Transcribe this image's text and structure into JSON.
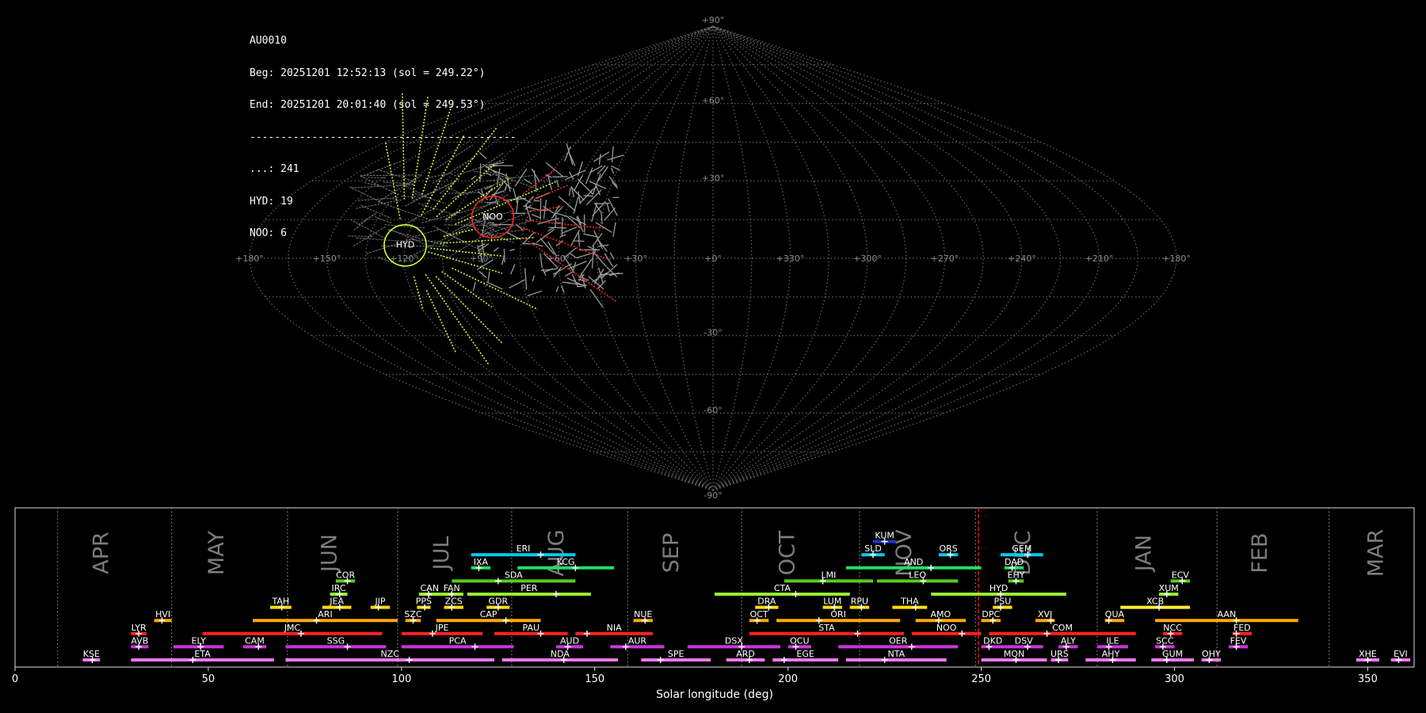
{
  "info": {
    "station": "AU0010",
    "begin": "Beg: 20251201 12:52:13 (sol = 249.22°)",
    "end": "End: 20251201 20:01:40 (sol = 249.53°)",
    "separator": "-------------------------------------------",
    "counts": [
      {
        "label": "...",
        "value": 241
      },
      {
        "label": "HYD",
        "value": 19
      },
      {
        "label": "NOO",
        "value": 6
      }
    ]
  },
  "sky_map": {
    "projection": "sinusoidal",
    "lon_ticks": [
      "+180°",
      "+150°",
      "+120°",
      "+90°",
      "+60°",
      "+30°",
      "+0°",
      "+330°",
      "+300°",
      "+270°",
      "+240°",
      "+210°",
      "+180°"
    ],
    "lat_ticks": [
      "+90°",
      "+60°",
      "+30°",
      "-30°",
      "-60°",
      "-90°"
    ],
    "radiants": [
      {
        "name": "HYD",
        "lon": 120,
        "lat": 5,
        "color": "#ccff33",
        "radius_deg": 5
      },
      {
        "name": "NOO",
        "lon": 89,
        "lat": 16,
        "color": "#ff2222",
        "radius_deg": 5
      }
    ]
  },
  "chart_data": {
    "type": "timeline",
    "xlabel": "Solar longitude (deg)",
    "xlim": [
      0,
      362
    ],
    "x_ticks": [
      0,
      50,
      100,
      150,
      200,
      250,
      300,
      350
    ],
    "current_sol": 249.3,
    "months": [
      {
        "name": "APR",
        "start": 11,
        "end": 40.5
      },
      {
        "name": "MAY",
        "start": 40.5,
        "end": 70.5
      },
      {
        "name": "JUN",
        "start": 70.5,
        "end": 99
      },
      {
        "name": "JUL",
        "start": 99,
        "end": 128.5
      },
      {
        "name": "AUG",
        "start": 128.5,
        "end": 158.5
      },
      {
        "name": "SEP",
        "start": 158.5,
        "end": 188
      },
      {
        "name": "OCT",
        "start": 188,
        "end": 218.5
      },
      {
        "name": "NOV",
        "start": 218.5,
        "end": 248.5
      },
      {
        "name": "DEC",
        "start": 248.5,
        "end": 280
      },
      {
        "name": "JAN",
        "start": 280,
        "end": 311
      },
      {
        "name": "FEB",
        "start": 311,
        "end": 340
      },
      {
        "name": "MAR",
        "start": 340,
        "end": 371
      }
    ],
    "showers": [
      {
        "name": "KSE",
        "start": 17.5,
        "end": 22,
        "peak": 20,
        "level": 0,
        "color": "#ee77ee"
      },
      {
        "name": "ETA",
        "start": 30,
        "end": 67,
        "peak": 46,
        "level": 0,
        "color": "#ee77ee"
      },
      {
        "name": "NZC",
        "start": 70,
        "end": 124,
        "peak": 102,
        "level": 0,
        "color": "#ee77ee"
      },
      {
        "name": "NDA",
        "start": 126,
        "end": 156,
        "peak": 142,
        "level": 0,
        "color": "#ee77ee"
      },
      {
        "name": "SPE",
        "start": 162,
        "end": 180,
        "peak": 167,
        "level": 0,
        "color": "#ee77ee"
      },
      {
        "name": "ARD",
        "start": 184,
        "end": 194,
        "peak": 190,
        "level": 0,
        "color": "#ee77ee"
      },
      {
        "name": "EGE",
        "start": 196,
        "end": 213,
        "peak": 199,
        "level": 0,
        "color": "#ee77ee"
      },
      {
        "name": "NTA",
        "start": 215,
        "end": 241,
        "peak": 225,
        "level": 0,
        "color": "#ee77ee"
      },
      {
        "name": "MON",
        "start": 250,
        "end": 267,
        "peak": 259,
        "level": 0,
        "color": "#ee77ee"
      },
      {
        "name": "URS",
        "start": 268,
        "end": 272.5,
        "peak": 270,
        "level": 0,
        "color": "#ee77ee"
      },
      {
        "name": "AHY",
        "start": 277,
        "end": 290,
        "peak": 284,
        "level": 0,
        "color": "#ee77ee"
      },
      {
        "name": "GUM",
        "start": 294,
        "end": 305,
        "peak": 298,
        "level": 0,
        "color": "#ee77ee"
      },
      {
        "name": "OHY",
        "start": 307,
        "end": 312,
        "peak": 309,
        "level": 0,
        "color": "#ee77ee"
      },
      {
        "name": "XHE",
        "start": 347,
        "end": 353,
        "peak": 350,
        "level": 0,
        "color": "#ee77ee"
      },
      {
        "name": "EVI",
        "start": 356,
        "end": 361,
        "peak": 358,
        "level": 0,
        "color": "#ee77ee"
      },
      {
        "name": "AVB",
        "start": 30,
        "end": 34.5,
        "peak": 32,
        "level": 1,
        "color": "#cc33dd"
      },
      {
        "name": "ELY",
        "start": 41,
        "end": 54,
        "peak": 48,
        "level": 1,
        "color": "#cc33dd"
      },
      {
        "name": "CAM",
        "start": 59,
        "end": 65,
        "peak": 63,
        "level": 1,
        "color": "#cc33dd"
      },
      {
        "name": "SSG",
        "start": 70,
        "end": 96,
        "peak": 86,
        "level": 1,
        "color": "#cc33dd"
      },
      {
        "name": "PCA",
        "start": 100,
        "end": 129,
        "peak": 119,
        "level": 1,
        "color": "#cc33dd"
      },
      {
        "name": "AUD",
        "start": 140,
        "end": 147,
        "peak": 143,
        "level": 1,
        "color": "#cc33dd"
      },
      {
        "name": "AUR",
        "start": 154,
        "end": 168,
        "peak": 158,
        "level": 1,
        "color": "#cc33dd"
      },
      {
        "name": "DSX",
        "start": 174,
        "end": 198,
        "peak": 188,
        "level": 1,
        "color": "#cc33dd"
      },
      {
        "name": "OCU",
        "start": 200,
        "end": 206,
        "peak": 202,
        "level": 1,
        "color": "#cc33dd"
      },
      {
        "name": "OER",
        "start": 213,
        "end": 244,
        "peak": 232,
        "level": 1,
        "color": "#cc33dd"
      },
      {
        "name": "DKD",
        "start": 250,
        "end": 256,
        "peak": 252,
        "level": 1,
        "color": "#cc33dd"
      },
      {
        "name": "DSV",
        "start": 256,
        "end": 266,
        "peak": 262,
        "level": 1,
        "color": "#cc33dd"
      },
      {
        "name": "ALY",
        "start": 270,
        "end": 275,
        "peak": 272,
        "level": 1,
        "color": "#cc33dd"
      },
      {
        "name": "ILE",
        "start": 280,
        "end": 288,
        "peak": 283,
        "level": 1,
        "color": "#cc33dd"
      },
      {
        "name": "SCC",
        "start": 295,
        "end": 300,
        "peak": 297,
        "level": 1,
        "color": "#cc33dd"
      },
      {
        "name": "FEV",
        "start": 314,
        "end": 319,
        "peak": 316,
        "level": 1,
        "color": "#cc33dd"
      },
      {
        "name": "LYR",
        "start": 30,
        "end": 34,
        "peak": 32,
        "level": 2,
        "color": "#ff2222"
      },
      {
        "name": "JMC",
        "start": 48.5,
        "end": 95,
        "peak": 74,
        "level": 2,
        "color": "#ff2222"
      },
      {
        "name": "JPE",
        "start": 100,
        "end": 121,
        "peak": 108,
        "level": 2,
        "color": "#ff2222"
      },
      {
        "name": "PAU",
        "start": 124,
        "end": 143,
        "peak": 136,
        "level": 2,
        "color": "#ff2222"
      },
      {
        "name": "NIA",
        "start": 145,
        "end": 165,
        "peak": 148,
        "level": 2,
        "color": "#ff2222"
      },
      {
        "name": "STA",
        "start": 190,
        "end": 230,
        "peak": 218,
        "level": 2,
        "color": "#ff2222"
      },
      {
        "name": "NOO",
        "start": 232,
        "end": 250,
        "peak": 245,
        "level": 2,
        "color": "#ff2222"
      },
      {
        "name": "COM",
        "start": 252,
        "end": 290,
        "peak": 267,
        "level": 2,
        "color": "#ff2222"
      },
      {
        "name": "NCC",
        "start": 297,
        "end": 302,
        "peak": 299,
        "level": 2,
        "color": "#ff2222"
      },
      {
        "name": "FED",
        "start": 315,
        "end": 320,
        "peak": 316,
        "level": 2,
        "color": "#ff2222"
      },
      {
        "name": "HVI",
        "start": 36,
        "end": 40.5,
        "peak": 38,
        "level": 3,
        "color": "#ffaa00"
      },
      {
        "name": "ARI",
        "start": 61.5,
        "end": 99,
        "peak": 78,
        "level": 3,
        "color": "#ffaa00"
      },
      {
        "name": "SZC",
        "start": 101,
        "end": 105,
        "peak": 103,
        "level": 3,
        "color": "#ffaa00"
      },
      {
        "name": "CAP",
        "start": 109,
        "end": 136,
        "peak": 127,
        "level": 3,
        "color": "#ffaa00"
      },
      {
        "name": "NUE",
        "start": 160,
        "end": 165,
        "peak": 163,
        "level": 3,
        "color": "#ffaa00"
      },
      {
        "name": "OCT",
        "start": 190,
        "end": 195,
        "peak": 192,
        "level": 3,
        "color": "#ffaa00"
      },
      {
        "name": "ORI",
        "start": 197,
        "end": 229,
        "peak": 208,
        "level": 3,
        "color": "#ffaa00"
      },
      {
        "name": "AMO",
        "start": 233,
        "end": 246,
        "peak": 239,
        "level": 3,
        "color": "#ffaa00"
      },
      {
        "name": "DPC",
        "start": 250,
        "end": 255,
        "peak": 253,
        "level": 3,
        "color": "#ffaa00"
      },
      {
        "name": "XVI",
        "start": 264,
        "end": 269,
        "peak": 268,
        "level": 3,
        "color": "#ffaa00"
      },
      {
        "name": "QUA",
        "start": 282,
        "end": 287,
        "peak": 283,
        "level": 3,
        "color": "#ffaa00"
      },
      {
        "name": "AAN",
        "start": 295,
        "end": 332,
        "peak": 316,
        "level": 3,
        "color": "#ffaa00"
      },
      {
        "name": "TAH",
        "start": 66,
        "end": 71.5,
        "peak": 69,
        "level": 4,
        "color": "#ffdd00"
      },
      {
        "name": "JEA",
        "start": 79.5,
        "end": 87,
        "peak": 84,
        "level": 4,
        "color": "#ffdd00"
      },
      {
        "name": "JIP",
        "start": 92,
        "end": 97,
        "peak": 94,
        "level": 4,
        "color": "#ffdd00"
      },
      {
        "name": "PPS",
        "start": 104,
        "end": 107.5,
        "peak": 106,
        "level": 4,
        "color": "#ffdd00"
      },
      {
        "name": "ZCS",
        "start": 111,
        "end": 116,
        "peak": 113,
        "level": 4,
        "color": "#ffdd00"
      },
      {
        "name": "GDR",
        "start": 122,
        "end": 128,
        "peak": 125,
        "level": 4,
        "color": "#ffdd00"
      },
      {
        "name": "DRA",
        "start": 191.5,
        "end": 197.5,
        "peak": 195,
        "level": 4,
        "color": "#ffdd00"
      },
      {
        "name": "LUM",
        "start": 209,
        "end": 214,
        "peak": 212,
        "level": 4,
        "color": "#ffdd00"
      },
      {
        "name": "RPU",
        "start": 216,
        "end": 221,
        "peak": 219,
        "level": 4,
        "color": "#ffdd00"
      },
      {
        "name": "THA",
        "start": 227,
        "end": 236,
        "peak": 233,
        "level": 4,
        "color": "#ffdd00"
      },
      {
        "name": "PSU",
        "start": 253,
        "end": 258,
        "peak": 255,
        "level": 4,
        "color": "#ffdd00"
      },
      {
        "name": "XCB",
        "start": 286,
        "end": 304,
        "peak": 296,
        "level": 4,
        "color": "#ffee33"
      },
      {
        "name": "IRC",
        "start": 81.5,
        "end": 86,
        "peak": 84,
        "level": 5,
        "color": "#99ee33"
      },
      {
        "name": "CAN",
        "start": 104.5,
        "end": 110,
        "peak": 107,
        "level": 5,
        "color": "#99ee33"
      },
      {
        "name": "FAN",
        "start": 110,
        "end": 116,
        "peak": 113,
        "level": 5,
        "color": "#99ee33"
      },
      {
        "name": "PER",
        "start": 117,
        "end": 149,
        "peak": 140,
        "level": 5,
        "color": "#99ee33"
      },
      {
        "name": "CTA",
        "start": 181,
        "end": 216,
        "peak": 202,
        "level": 5,
        "color": "#99ee33"
      },
      {
        "name": "HYD",
        "start": 237,
        "end": 272,
        "peak": 255,
        "level": 5,
        "color": "#99ee33"
      },
      {
        "name": "XUM",
        "start": 296,
        "end": 301,
        "peak": 298,
        "level": 5,
        "color": "#99ee33"
      },
      {
        "name": "COR",
        "start": 83,
        "end": 88,
        "peak": 86,
        "level": 6,
        "color": "#55cc22"
      },
      {
        "name": "SDA",
        "start": 113,
        "end": 145,
        "peak": 125,
        "level": 6,
        "color": "#55cc22"
      },
      {
        "name": "LMI",
        "start": 199,
        "end": 222,
        "peak": 209,
        "level": 6,
        "color": "#55cc22"
      },
      {
        "name": "LEO",
        "start": 223,
        "end": 244,
        "peak": 235,
        "level": 6,
        "color": "#55cc22"
      },
      {
        "name": "EHY",
        "start": 257,
        "end": 261,
        "peak": 259,
        "level": 6,
        "color": "#55cc22"
      },
      {
        "name": "ECV",
        "start": 299,
        "end": 304,
        "peak": 302,
        "level": 6,
        "color": "#55cc22"
      },
      {
        "name": "IXA",
        "start": 118,
        "end": 123,
        "peak": 120,
        "level": 7,
        "color": "#22dd66"
      },
      {
        "name": "KCG",
        "start": 130,
        "end": 155,
        "peak": 145,
        "level": 7,
        "color": "#22dd66"
      },
      {
        "name": "AND",
        "start": 215,
        "end": 250,
        "peak": 237,
        "level": 7,
        "color": "#22dd66"
      },
      {
        "name": "DAD",
        "start": 256,
        "end": 261,
        "peak": 258,
        "level": 7,
        "color": "#22dd66"
      },
      {
        "name": "ERI",
        "start": 118,
        "end": 145,
        "peak": 136,
        "level": 8,
        "color": "#00ccee"
      },
      {
        "name": "SLD",
        "start": 219,
        "end": 225,
        "peak": 222,
        "level": 8,
        "color": "#00ccee"
      },
      {
        "name": "ORS",
        "start": 239,
        "end": 244,
        "peak": 242,
        "level": 8,
        "color": "#00ccee"
      },
      {
        "name": "GEM",
        "start": 255,
        "end": 266,
        "peak": 262,
        "level": 8,
        "color": "#00ccee"
      },
      {
        "name": "KUM",
        "start": 222,
        "end": 228,
        "peak": 225,
        "level": 9,
        "color": "#2233cc"
      }
    ]
  }
}
